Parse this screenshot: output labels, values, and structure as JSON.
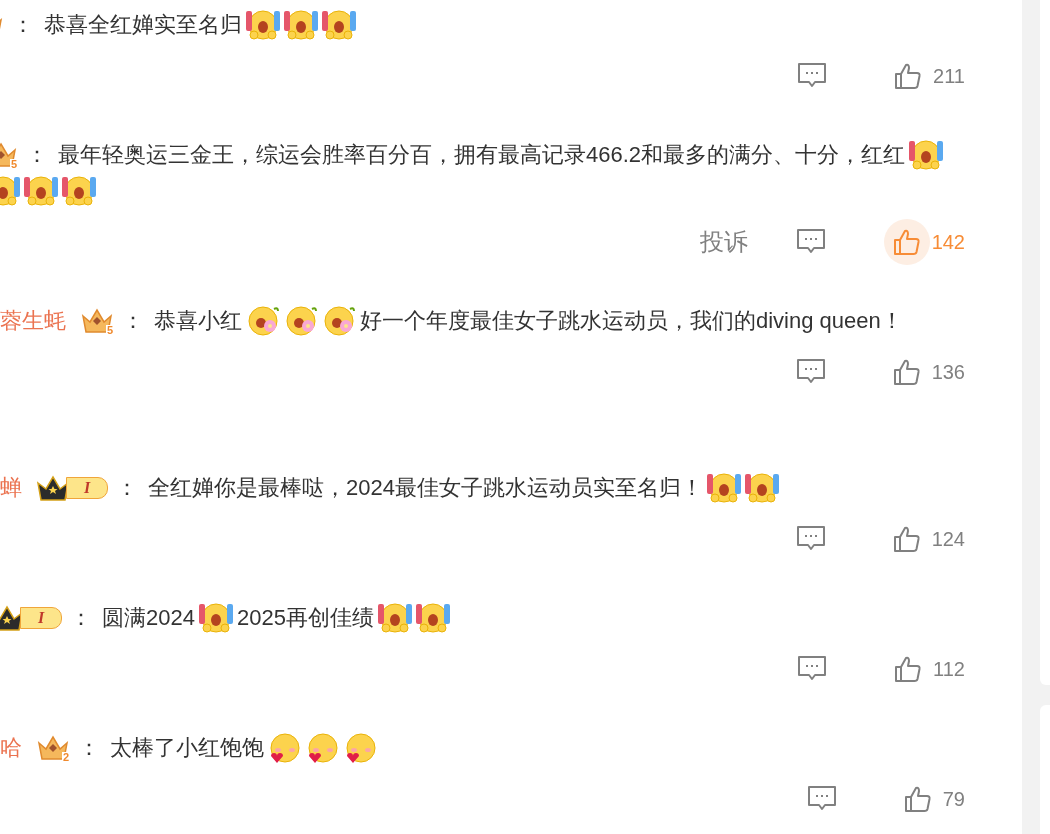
{
  "comments": [
    {
      "badge": {
        "kind": "crown-gold"
      },
      "separator": "：",
      "content": [
        {
          "kind": "text",
          "text": "恭喜全红婵实至名归"
        },
        {
          "kind": "cheer"
        },
        {
          "kind": "cheer"
        },
        {
          "kind": "cheer"
        }
      ],
      "liked": false,
      "likes": "211"
    },
    {
      "badge": {
        "kind": "crown-gold",
        "text": "5"
      },
      "separator": "：",
      "content": [
        {
          "kind": "text",
          "text": "最年轻奥运三金王，综运会胜率百分百，拥有最高记录466.2和最多的满分、十分，红红"
        },
        {
          "kind": "cheer"
        },
        {
          "kind": "cheer"
        },
        {
          "kind": "cheer"
        },
        {
          "kind": "cheer"
        }
      ],
      "report": "投诉",
      "liked": true,
      "likes": "142"
    },
    {
      "name": "蓉生蚝",
      "badge": {
        "kind": "crown-gold",
        "text": "5"
      },
      "separator": "：",
      "content": [
        {
          "kind": "text",
          "text": "恭喜小红"
        },
        {
          "kind": "flower"
        },
        {
          "kind": "flower"
        },
        {
          "kind": "flower"
        },
        {
          "kind": "text",
          "text": "好一个年度最佳女子跳水运动员，我们的diving queen！"
        }
      ],
      "liked": false,
      "likes": "136"
    },
    {
      "name": "蝉",
      "badge": {
        "kind": "crown-black",
        "text": "I"
      },
      "separator": "：",
      "content": [
        {
          "kind": "text",
          "text": "全红婵你是最棒哒，2024最佳女子跳水运动员实至名归！"
        },
        {
          "kind": "cheer"
        },
        {
          "kind": "cheer"
        }
      ],
      "liked": false,
      "likes": "124"
    },
    {
      "badge": {
        "kind": "crown-black",
        "text": "I"
      },
      "separator": "：",
      "content": [
        {
          "kind": "text",
          "text": "圆满2024"
        },
        {
          "kind": "cheer"
        },
        {
          "kind": "text",
          "text": "2025再创佳绩"
        },
        {
          "kind": "cheer"
        },
        {
          "kind": "cheer"
        }
      ],
      "liked": false,
      "likes": "112"
    },
    {
      "name": "哈",
      "badge": {
        "kind": "crown-gold",
        "text": "2"
      },
      "separator": "：",
      "content": [
        {
          "kind": "text",
          "text": "太棒了小红饱饱"
        },
        {
          "kind": "blush"
        },
        {
          "kind": "blush"
        },
        {
          "kind": "blush"
        }
      ],
      "liked": false,
      "likes": "79"
    }
  ]
}
